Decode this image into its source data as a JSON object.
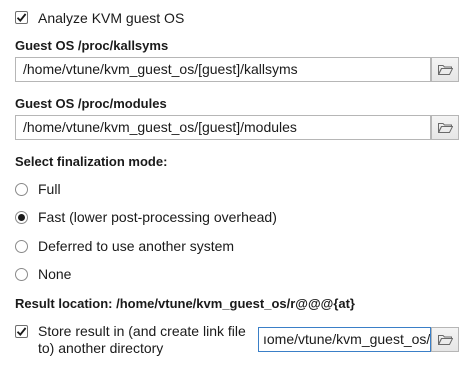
{
  "analyze_kvm": {
    "label": "Analyze KVM guest OS",
    "checked": true
  },
  "kallsyms": {
    "heading": "Guest OS /proc/kallsyms",
    "value": "/home/vtune/kvm_guest_os/[guest]/kallsyms"
  },
  "modules": {
    "heading": "Guest OS /proc/modules",
    "value": "/home/vtune/kvm_guest_os/[guest]/modules"
  },
  "finalization": {
    "heading": "Select finalization mode:",
    "options": [
      {
        "label": "Full",
        "selected": false
      },
      {
        "label": "Fast (lower post-processing overhead)",
        "selected": true
      },
      {
        "label": "Deferred to use another system",
        "selected": false
      },
      {
        "label": "None",
        "selected": false
      }
    ]
  },
  "result": {
    "location_label": "Result location: /home/vtune/kvm_guest_os/r@@@{at}",
    "store_label_line1": "Store result in (and create link file",
    "store_label_line2": "to) another directory",
    "store_checked": true,
    "directory_value": "ıome/vtune/kvm_guest_os/"
  },
  "icons": {
    "checkbox": "checkmark-icon",
    "browse": "folder-open-icon"
  }
}
